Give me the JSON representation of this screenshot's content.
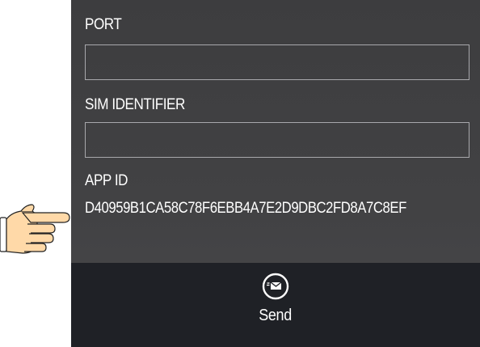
{
  "form": {
    "port_label": "PORT",
    "port_value": "",
    "sim_label": "SIM IDENTIFIER",
    "sim_value": "",
    "app_id_label": "APP ID",
    "app_id_value": "D40959B1CA58C78F6EBB4A7E2D9DBC2FD8A7C8EF"
  },
  "footer": {
    "send_label": "Send",
    "send_icon": "envelope-send-icon"
  },
  "pointer": {
    "icon": "pointing-hand-icon"
  },
  "colors": {
    "panel_bg": "#424244",
    "bottom_bar_bg": "#1f2126",
    "input_border": "#a8a8ac",
    "text": "#ffffff",
    "hand_fill": "#ffd9a8"
  }
}
